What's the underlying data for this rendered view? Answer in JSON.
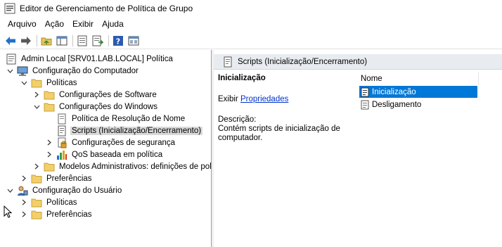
{
  "window": {
    "title": "Editor de Gerenciamento de Política de Grupo",
    "icon": "gpme-app-icon"
  },
  "menubar": {
    "items": [
      "Arquivo",
      "Ação",
      "Exibir",
      "Ajuda"
    ]
  },
  "toolbar": {
    "buttons": [
      "back-arrow-icon",
      "forward-arrow-icon",
      "up-folder-icon",
      "show-hide-tree-icon",
      "properties-icon",
      "export-list-icon",
      "help-icon",
      "view-icon"
    ]
  },
  "tree": {
    "root": "Admin Local [SRV01.LAB.LOCAL] Política",
    "computer_config": "Configuração do Computador",
    "policies": "Políticas",
    "software_settings": "Configurações de Software",
    "windows_settings": "Configurações do Windows",
    "name_resolution": "Política de Resolução de Nome",
    "scripts": "Scripts (Inicialização/Encerramento)",
    "security_settings": "Configurações de segurança",
    "qos": "QoS baseada em política",
    "admin_templates": "Modelos Administrativos: definições de pol",
    "preferences": "Preferências",
    "user_config": "Configuração do Usuário",
    "user_policies": "Políticas",
    "user_preferences": "Preferências"
  },
  "details": {
    "header": "Scripts (Inicialização/Encerramento)",
    "heading": "Inicialização",
    "show_prefix": "Exibir",
    "properties_link": "Propriedades",
    "description_label": "Descrição:",
    "description_text": "Contém scripts de inicialização de computador.",
    "column_name": "Nome",
    "items": [
      "Inicialização",
      "Desligamento"
    ],
    "selected_item": "Inicialização"
  },
  "colors": {
    "selection": "#0078d7",
    "link": "#0033cc",
    "tree_selected": "#d9d9d9",
    "header_bg": "#e8ecf0"
  }
}
